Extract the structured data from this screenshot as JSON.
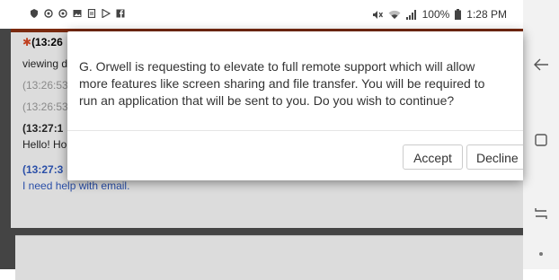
{
  "status_bar": {
    "battery": "100%",
    "time": "1:28 PM"
  },
  "chat": {
    "messages": [
      {
        "text": "(13:26",
        "color": "#222222",
        "bold": true
      },
      {
        "text": "viewing d",
        "color": "#222222",
        "bold": false
      },
      {
        "text": "(13:26:53",
        "color": "#8a8a8a",
        "bold": false
      },
      {
        "text": "(13:26:53",
        "color": "#8a8a8a",
        "bold": false
      },
      {
        "text": "(13:27:1",
        "color": "#222222",
        "bold": true
      },
      {
        "text": "Hello! Ho",
        "color": "#222222",
        "bold": false
      },
      {
        "text": "(13:27:3",
        "color": "#2a4fa8",
        "bold": true
      },
      {
        "text": "I need help with email.",
        "color": "#2a4fa8",
        "bold": false
      }
    ]
  },
  "dialog": {
    "message": "G. Orwell is requesting to elevate to full remote support which will allow more features like screen sharing and file transfer. You will be required to run an application that will be sent to you. Do you wish to continue?",
    "accept_label": "Accept",
    "decline_label": "Decline"
  },
  "colors": {
    "accent": "#7a2a10",
    "overlay": "#444444",
    "chat_bg": "#dcdcdc"
  }
}
